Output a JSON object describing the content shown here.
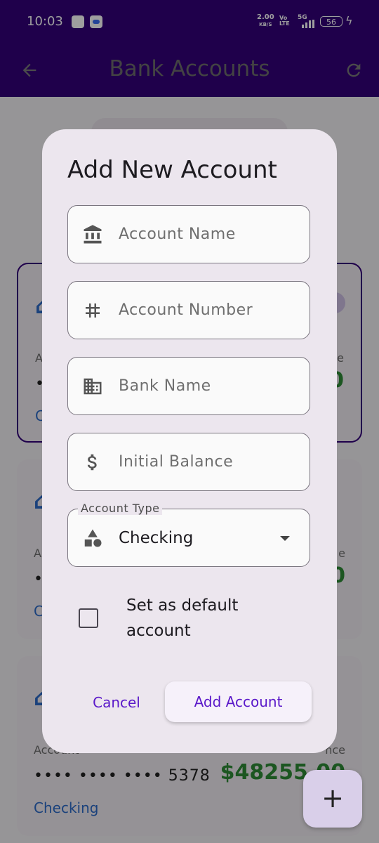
{
  "status_bar": {
    "time": "10:03",
    "speed_value": "2.00",
    "speed_unit": "KB/S",
    "volte": "Vo LTE",
    "network": "5G",
    "battery": "56"
  },
  "app_bar": {
    "title": "Bank Accounts",
    "back_icon": "arrow-back-icon",
    "refresh_icon": "refresh-icon"
  },
  "background_cards": [
    {
      "number_partial": "•",
      "type_partial": "C",
      "label_left": "A",
      "label_right": "e",
      "balance_partial": "0"
    },
    {
      "number_partial": "•",
      "type_partial": "C",
      "label_left": "A",
      "label_right": "e",
      "balance_partial": "0"
    },
    {
      "number": "•••• •••• •••• 5378",
      "type": "Checking",
      "label_left": "Account",
      "label_right": "nce",
      "balance_partial": "$48255.00"
    }
  ],
  "fab": {
    "label": "+"
  },
  "dialog": {
    "title": "Add New Account",
    "fields": [
      {
        "placeholder": "Account Name",
        "icon": "bank-icon"
      },
      {
        "placeholder": "Account Number",
        "icon": "hash-icon"
      },
      {
        "placeholder": "Bank Name",
        "icon": "building-icon"
      },
      {
        "placeholder": "Initial Balance",
        "icon": "dollar-icon"
      }
    ],
    "account_type": {
      "label": "Account Type",
      "value": "Checking",
      "icon": "category-icon"
    },
    "default_checkbox": {
      "label": "Set as default account",
      "checked": false
    },
    "cancel_label": "Cancel",
    "add_label": "Add Account"
  },
  "colors": {
    "primary": "#32007a",
    "accent": "#5a18c9",
    "balance_green": "#2e8b36",
    "link_blue": "#2d6bc9"
  }
}
